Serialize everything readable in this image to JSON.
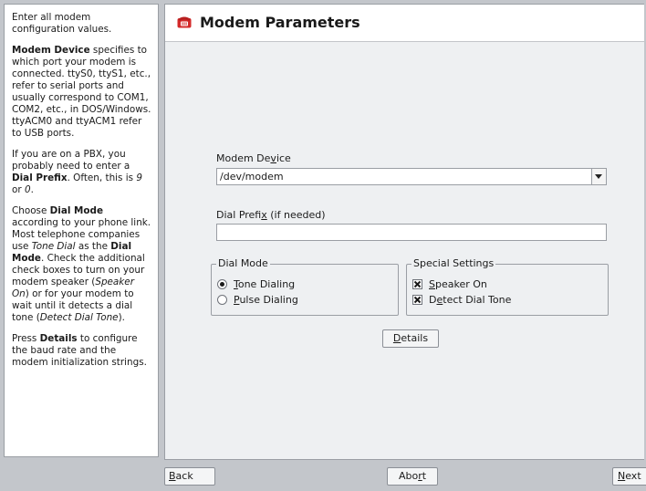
{
  "help": {
    "p1": "Enter all modem configuration values.",
    "p2_bold": "Modem Device",
    "p2_rest": " specifies to which port your modem is connected. ttyS0, ttyS1, etc., refer to serial ports and usually correspond to COM1, COM2, etc., in DOS/Windows. ttyACM0 and ttyACM1 refer to USB ports.",
    "p3_a": "If you are on a PBX, you probably need to enter a ",
    "p3_bold": "Dial Prefix",
    "p3_b": ". Often, this is ",
    "p3_i1": "9",
    "p3_c": " or ",
    "p3_i2": "0",
    "p3_d": ".",
    "p4_a": "Choose ",
    "p4_bold1": "Dial Mode",
    "p4_b": " according to your phone link. Most telephone companies use ",
    "p4_i1": "Tone Dial",
    "p4_c": " as the ",
    "p4_bold2": "Dial Mode",
    "p4_d": ". Check the additional check boxes to turn on your modem speaker (",
    "p4_i2": "Speaker On",
    "p4_e": ") or for your modem to wait until it detects a dial tone (",
    "p4_i3": "Detect Dial Tone",
    "p4_f": ").",
    "p5_a": "Press ",
    "p5_bold": "Details",
    "p5_b": " to configure the baud rate and the modem initialization strings."
  },
  "header": {
    "title": "Modem Parameters",
    "icon": "phone-icon",
    "icon_color": "#d42a2a"
  },
  "form": {
    "modem_device": {
      "label_pre": "Modem De",
      "label_u": "v",
      "label_post": "ice",
      "value": "/dev/modem"
    },
    "dial_prefix": {
      "label_pre": "Dial Prefi",
      "label_u": "x",
      "label_post": " (if needed)",
      "value": ""
    },
    "dial_mode": {
      "legend": "Dial Mode",
      "tone": {
        "u": "T",
        "rest": "one Dialing",
        "selected": true
      },
      "pulse": {
        "u": "P",
        "rest": "ulse Dialing",
        "selected": false
      }
    },
    "special_settings": {
      "legend": "Special Settings",
      "speaker": {
        "u": "S",
        "rest": "peaker On",
        "checked": true
      },
      "detect": {
        "pre": "D",
        "u": "e",
        "rest": "tect Dial Tone",
        "checked": true
      }
    },
    "details": {
      "u": "D",
      "rest": "etails"
    }
  },
  "footer": {
    "back": {
      "u": "B",
      "rest": "ack"
    },
    "abort": {
      "pre": "Abo",
      "u": "r",
      "rest": "t"
    },
    "next": {
      "u": "N",
      "rest": "ext"
    }
  }
}
